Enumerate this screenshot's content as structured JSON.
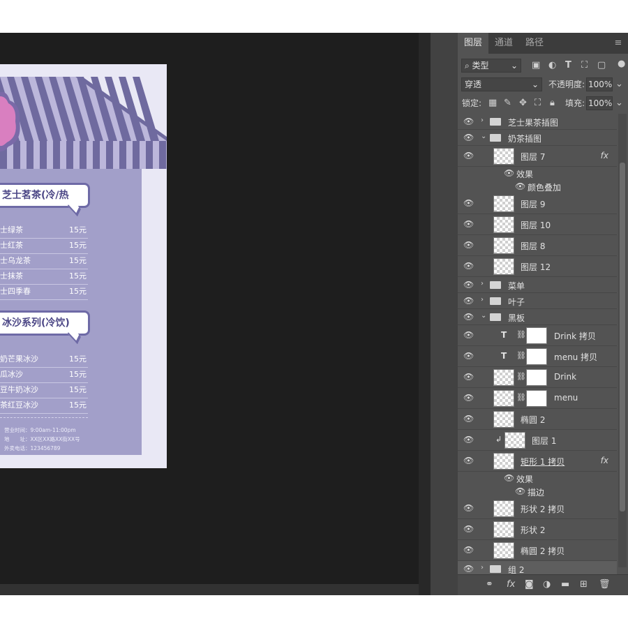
{
  "panel": {
    "tabs": [
      "图层",
      "通道",
      "路径"
    ],
    "filter_kind": "类型",
    "blend_mode": "穿透",
    "opacity_label": "不透明度:",
    "opacity_value": "100%",
    "lock_label": "锁定:",
    "fill_label": "填充:",
    "fill_value": "100%"
  },
  "layers": [
    {
      "name": "芝士果茶插图",
      "kind": "group",
      "state": "collapsed"
    },
    {
      "name": "奶茶插图",
      "kind": "group",
      "state": "expanded"
    },
    {
      "name": "图层 7",
      "kind": "pixel",
      "fx": "fx"
    },
    {
      "name": "效果",
      "kind": "effect"
    },
    {
      "name": "颜色叠加",
      "kind": "effect"
    },
    {
      "name": "图层 9",
      "kind": "pixel"
    },
    {
      "name": "图层 10",
      "kind": "pixel"
    },
    {
      "name": "图层 8",
      "kind": "pixel"
    },
    {
      "name": "图层 12",
      "kind": "pixel"
    },
    {
      "name": "菜单",
      "kind": "group",
      "state": "collapsed"
    },
    {
      "name": "叶子",
      "kind": "group",
      "state": "collapsed"
    },
    {
      "name": "黑板",
      "kind": "group",
      "state": "expanded"
    },
    {
      "name": "Drink 拷贝",
      "kind": "text"
    },
    {
      "name": "menu 拷贝",
      "kind": "text"
    },
    {
      "name": "Drink",
      "kind": "masked"
    },
    {
      "name": "menu",
      "kind": "masked"
    },
    {
      "name": "椭圆 2",
      "kind": "shape"
    },
    {
      "name": "图层 1",
      "kind": "clipped"
    },
    {
      "name": "矩形 1 拷贝",
      "kind": "shape",
      "fx": "fx"
    },
    {
      "name": "效果",
      "kind": "effect"
    },
    {
      "name": "描边",
      "kind": "effect"
    },
    {
      "name": "形状 2 拷贝",
      "kind": "shape"
    },
    {
      "name": "形状 2",
      "kind": "shape"
    },
    {
      "name": "椭圆 2 拷贝",
      "kind": "shape"
    },
    {
      "name": "组 2",
      "kind": "group",
      "state": "collapsed",
      "selected": true
    }
  ],
  "document": {
    "section1_title": "芝士茗茶(冷/热",
    "section1_items": [
      {
        "name": "士绿茶",
        "price": "15元"
      },
      {
        "name": "士红茶",
        "price": "15元"
      },
      {
        "name": "士乌龙茶",
        "price": "15元"
      },
      {
        "name": "士抹茶",
        "price": "15元"
      },
      {
        "name": "士四季春",
        "price": "15元"
      }
    ],
    "section2_title": "冰沙系列(冷饮)",
    "section2_items": [
      {
        "name": "奶芒果冰沙",
        "price": "15元"
      },
      {
        "name": "瓜冰沙",
        "price": "15元"
      },
      {
        "name": "豆牛奶冰沙",
        "price": "15元"
      },
      {
        "name": "茶红豆冰沙",
        "price": "15元"
      }
    ],
    "info": [
      "营业时间：9:00am-11:00pm",
      "地　　址：XX区XX路XX街XX号",
      "外卖电话：123456789"
    ]
  },
  "colors": {
    "board": "#a29fc9",
    "paper": "#e9e8f5",
    "stripe_dark": "#6f6a9f",
    "stripe_light": "#bcb7db",
    "badge": "#d97fc0"
  },
  "icons": {
    "visibility": "eye-icon",
    "group": "folder-icon",
    "text_layer": "type-icon",
    "link": "chain-link-icon"
  }
}
